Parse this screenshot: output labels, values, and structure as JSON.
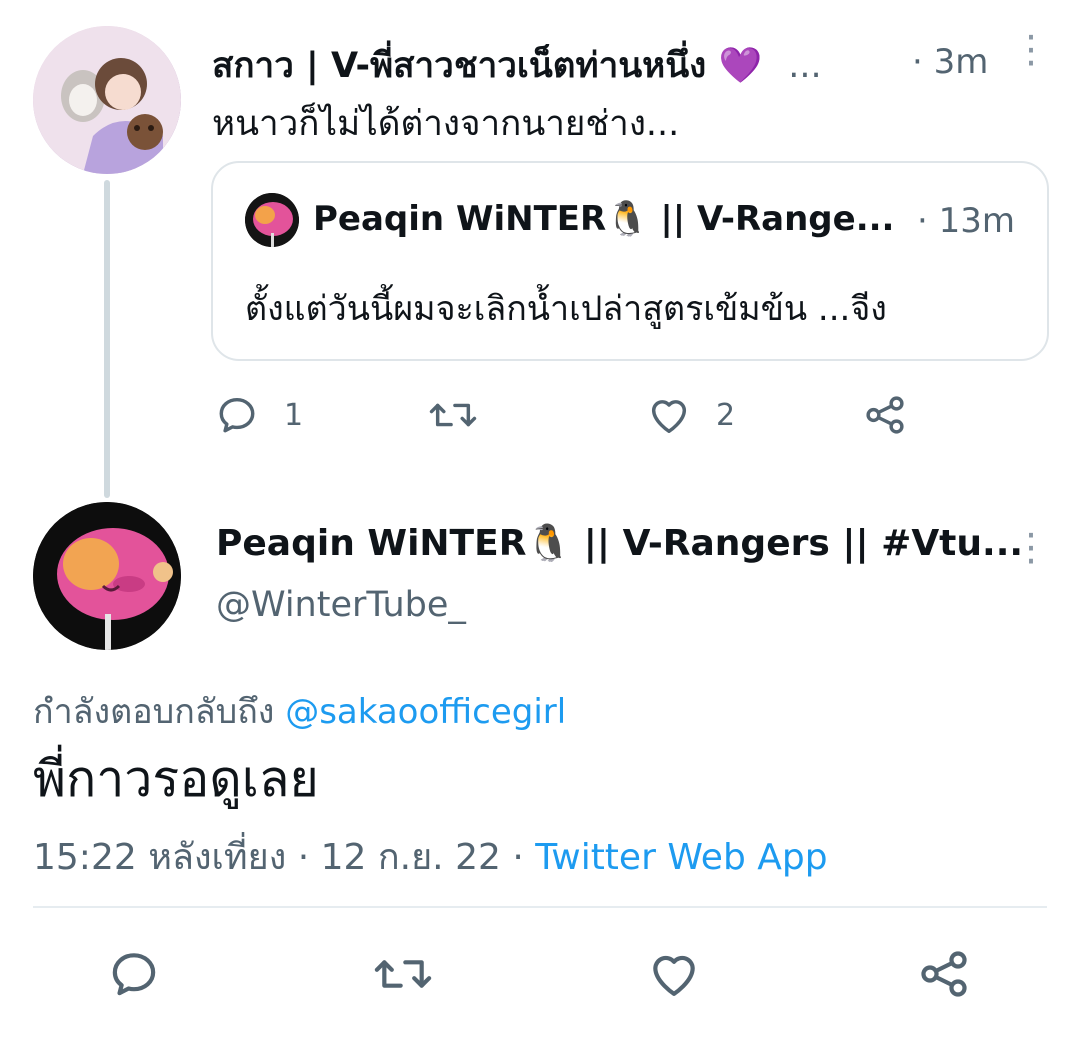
{
  "parent_tweet": {
    "author_name": "สกาว | V-พี่สาวชาวเน็ตท่านหนึ่ง",
    "name_emoji": "💜",
    "name_overflow": "...",
    "time": "· 3m",
    "text": "หนาวก็ไม่ได้ต่างจากนายช่าง...",
    "quoted": {
      "author_name": "Peaqin WiNTER🐧 || V-Range...",
      "time": "· 13m",
      "text": "ตั้งแต่วันนี้ผมจะเลิกน้ำเปล่าสูตรเข้มข้น ...จีง"
    },
    "actions": {
      "reply_count": "1",
      "retweet_count": "",
      "like_count": "2"
    }
  },
  "main_tweet": {
    "author_name": "Peaqin WiNTER🐧 || V-Rangers || #Vtu...",
    "handle": "@WinterTube_",
    "replying_prefix": "กำลังตอบกลับถึง",
    "replying_mention": "@sakaoofficegirl",
    "text": "พี่กาวรอดูเลย",
    "timestamp": "15:22 หลังเที่ยง · 12 ก.ย. 22 ·",
    "source": "Twitter Web App"
  },
  "icons": {
    "more": "⋮",
    "reply": "reply-icon",
    "retweet": "retweet-icon",
    "like": "like-icon",
    "share": "share-icon"
  },
  "colors": {
    "accent": "#1d9bf0",
    "secondary_text": "#536471",
    "thread_line": "#cfd9de",
    "heart": "#b08ee0"
  }
}
